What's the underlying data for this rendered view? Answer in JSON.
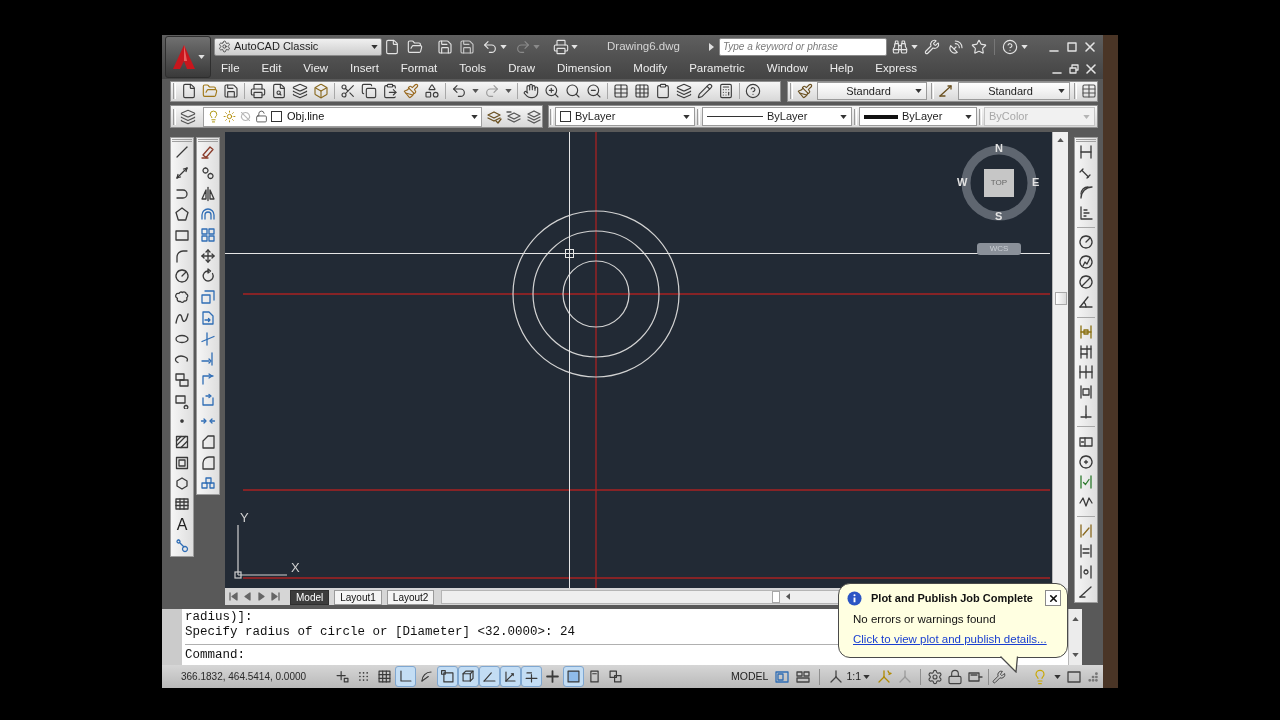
{
  "title_bar": {
    "workspace": "AutoCAD Classic",
    "document_title": "Drawing6.dwg",
    "search": {
      "placeholder": "Type a keyword or phrase"
    }
  },
  "menu": [
    "File",
    "Edit",
    "View",
    "Insert",
    "Format",
    "Tools",
    "Draw",
    "Dimension",
    "Modify",
    "Parametric",
    "Window",
    "Help",
    "Express"
  ],
  "styles_toolbar": {
    "text_style": "Standard",
    "dimension_style": "Standard"
  },
  "layers_toolbar": {
    "layer": "Obj.line"
  },
  "properties_toolbar": {
    "color_value": "ByLayer",
    "linetype": "ByLayer",
    "lineweight": "ByLayer",
    "plot_style": {
      "value": "ByColor",
      "disabled": true
    }
  },
  "draw_toolbar": {
    "text_tool_glyph": "A"
  },
  "viewcube": {
    "face": "TOP",
    "compass": {
      "north": "N",
      "east": "E",
      "south": "S",
      "west": "W"
    },
    "coordinate_system": "WCS"
  },
  "ucs_icon": {
    "y_label": "Y",
    "x_label": "X"
  },
  "layout_tabs": [
    {
      "label": "Model",
      "selected": true
    },
    {
      "label": "Layout1",
      "selected": false
    },
    {
      "label": "Layout2",
      "selected": false
    }
  ],
  "command_window": {
    "history": [
      "radius)]:",
      "Specify radius of circle or [Diameter] <32.0000>: 24"
    ],
    "prompt": "Command:"
  },
  "status_bar": {
    "coordinates": "366.1832, 464.5414, 0.0000",
    "toggles": [
      {
        "kind": "infer",
        "on": false
      },
      {
        "kind": "snap",
        "on": false
      },
      {
        "kind": "grid",
        "on": false
      },
      {
        "kind": "ortho",
        "on": true
      },
      {
        "kind": "polar",
        "on": false
      },
      {
        "kind": "osnap",
        "on": true
      },
      {
        "kind": "osnap3d",
        "on": true
      },
      {
        "kind": "otrack",
        "on": true
      },
      {
        "kind": "ducs",
        "on": true
      },
      {
        "kind": "dyn",
        "on": true
      },
      {
        "kind": "lwt",
        "on": false
      },
      {
        "kind": "tpy",
        "on": true
      },
      {
        "kind": "qp",
        "on": false
      },
      {
        "kind": "sc",
        "on": false
      }
    ],
    "space": "MODEL",
    "annotation_scale": "1:1"
  },
  "notification": {
    "title": "Plot and Publish Job Complete",
    "message": "No errors or warnings found",
    "link": "Click to view plot and publish details..."
  }
}
